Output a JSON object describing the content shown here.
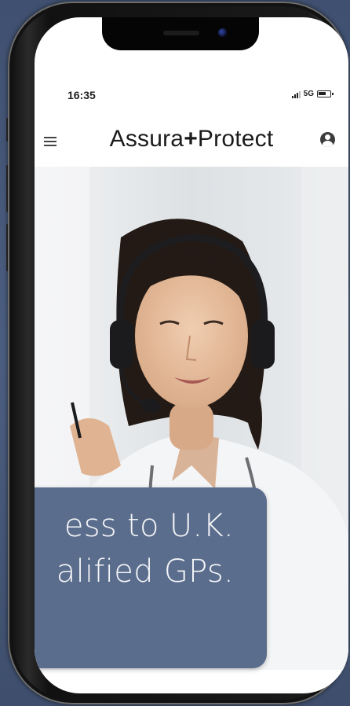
{
  "status_bar": {
    "time": "16:35",
    "network": "5G",
    "icons": [
      "signal-icon",
      "battery-icon"
    ]
  },
  "app_header": {
    "title_left": "Assura",
    "title_plus": "+",
    "title_right": "Protect",
    "icons": [
      "menu-icon",
      "profile-icon"
    ]
  },
  "video_call": {
    "subject": "doctor-with-headset"
  },
  "caption": {
    "line1": "ess to U.K.",
    "line2": "alified GPs.",
    "background_color": "#5b6d8d"
  },
  "colors": {
    "background": "#4a5b7c",
    "phone_frame": "#111111",
    "caption_text": "#f5f6f8"
  }
}
